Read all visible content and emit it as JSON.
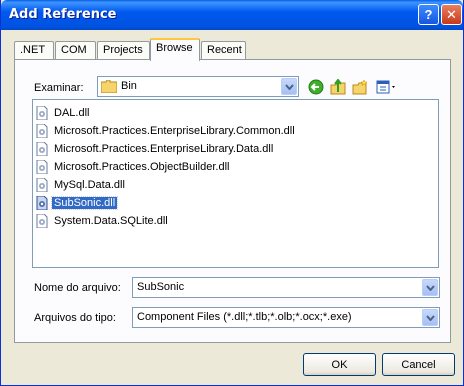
{
  "window": {
    "title": "Add Reference"
  },
  "tabs": [
    {
      "label": ".NET"
    },
    {
      "label": "COM"
    },
    {
      "label": "Projects"
    },
    {
      "label": "Browse",
      "active": true
    },
    {
      "label": "Recent"
    }
  ],
  "browse": {
    "look_in_label": "Examinar:",
    "look_in_value": "Bin",
    "files": [
      {
        "name": "DAL.dll",
        "selected": false
      },
      {
        "name": "Microsoft.Practices.EnterpriseLibrary.Common.dll",
        "selected": false
      },
      {
        "name": "Microsoft.Practices.EnterpriseLibrary.Data.dll",
        "selected": false
      },
      {
        "name": "Microsoft.Practices.ObjectBuilder.dll",
        "selected": false
      },
      {
        "name": "MySql.Data.dll",
        "selected": false
      },
      {
        "name": "SubSonic.dll",
        "selected": true
      },
      {
        "name": "System.Data.SQLite.dll",
        "selected": false
      }
    ],
    "file_name_label": "Nome do arquivo:",
    "file_name_value": "SubSonic",
    "file_type_label": "Arquivos do tipo:",
    "file_type_value": "Component Files (*.dll;*.tlb;*.olb;*.ocx;*.exe)"
  },
  "buttons": {
    "ok": "OK",
    "cancel": "Cancel"
  },
  "icons": {
    "help": "help-icon",
    "close": "close-icon",
    "folder": "folder-icon",
    "back": "back-icon",
    "up": "up-folder-icon",
    "new_folder": "new-folder-icon",
    "views": "views-menu-icon",
    "file": "dll-file-icon",
    "dropdown": "chevron-down-icon"
  },
  "colors": {
    "titlebar": "#0058ee",
    "selection": "#316ac5",
    "dialog_bg": "#ece9d8",
    "tab_accent": "#ffc83c"
  }
}
